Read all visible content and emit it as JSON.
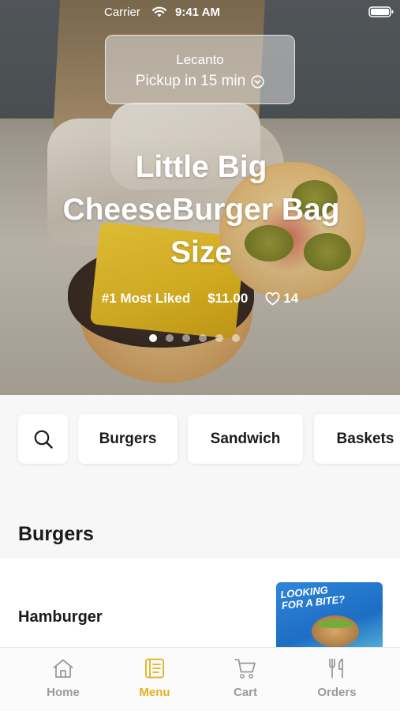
{
  "status_bar": {
    "carrier": "Carrier",
    "time": "9:41 AM"
  },
  "location": {
    "name": "Lecanto",
    "pickup": "Pickup in 15 min"
  },
  "featured": {
    "title": "Little Big CheeseBurger Bag Size",
    "rank": "#1 Most Liked",
    "price": "$11.00",
    "likes": "14",
    "carousel_count": 6,
    "carousel_active_index": 0
  },
  "categories": [
    "Burgers",
    "Sandwich",
    "Baskets"
  ],
  "section": {
    "title": "Burgers"
  },
  "items": [
    {
      "name": "Hamburger",
      "promo_text": [
        "LOOKING",
        "FOR A BITE?"
      ]
    }
  ],
  "tabs": [
    {
      "label": "Home",
      "icon": "home-icon"
    },
    {
      "label": "Menu",
      "icon": "menu-book-icon",
      "active": true
    },
    {
      "label": "Cart",
      "icon": "cart-icon"
    },
    {
      "label": "Orders",
      "icon": "fork-knife-icon"
    }
  ],
  "colors": {
    "accent": "#e2b21c",
    "tab_inactive": "#9a9a9a",
    "text": "#1b1b1b"
  }
}
